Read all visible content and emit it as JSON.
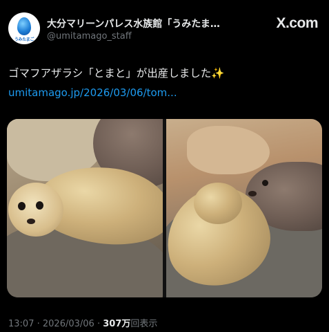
{
  "account": {
    "display_name": "大分マリーンパレス水族館「うみたま…",
    "handle": "@umitamago_staff",
    "avatar_label": "うみたまご"
  },
  "brand": "X.com",
  "post": {
    "text": "ゴマフアザラシ「とまと」が出産しました✨",
    "link": "umitamago.jp/2026/03/06/tom..."
  },
  "media": {
    "images": [
      {
        "name": "seal-pup-photo"
      },
      {
        "name": "seal-mother-and-pup-photo"
      }
    ]
  },
  "meta": {
    "time": "13:07",
    "separator": "·",
    "date": "2026/03/06",
    "views_count": "307万",
    "views_label": "回表示"
  },
  "colors": {
    "background": "#000000",
    "text": "#e7e9ea",
    "secondary": "#71767b",
    "link": "#1d9bf0"
  }
}
